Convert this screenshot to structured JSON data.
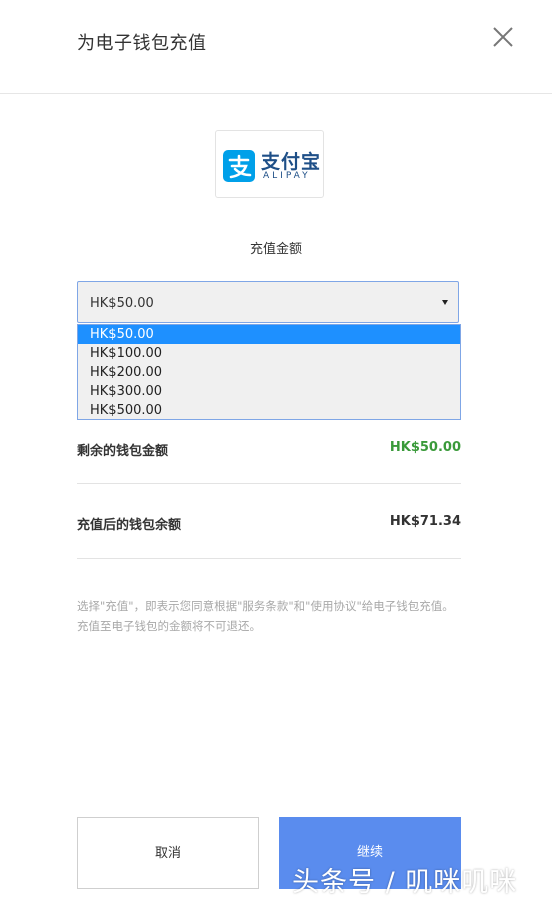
{
  "dialog": {
    "title": "为电子钱包充值"
  },
  "logo": {
    "name_cn": "支付宝",
    "name_en": "ALIPAY",
    "brand_color": "#00a0e9"
  },
  "amount": {
    "label": "充值金额",
    "selected": "HK$50.00",
    "options": [
      "HK$50.00",
      "HK$100.00",
      "HK$200.00",
      "HK$300.00",
      "HK$500.00"
    ]
  },
  "summary": {
    "remaining_label": "剩余的钱包金额",
    "remaining_value": "HK$50.00",
    "after_label": "充值后的钱包余额",
    "after_value": "HK$71.34"
  },
  "notice": {
    "line1": "选择\"充值\"，即表示您同意根据\"服务条款\"和\"使用协议\"给电子钱包充值。",
    "line2": "充值至电子钱包的金额将不可退还。"
  },
  "buttons": {
    "cancel": "取消",
    "continue": "继续"
  },
  "watermark": "头条号 / 叽咪叽咪"
}
